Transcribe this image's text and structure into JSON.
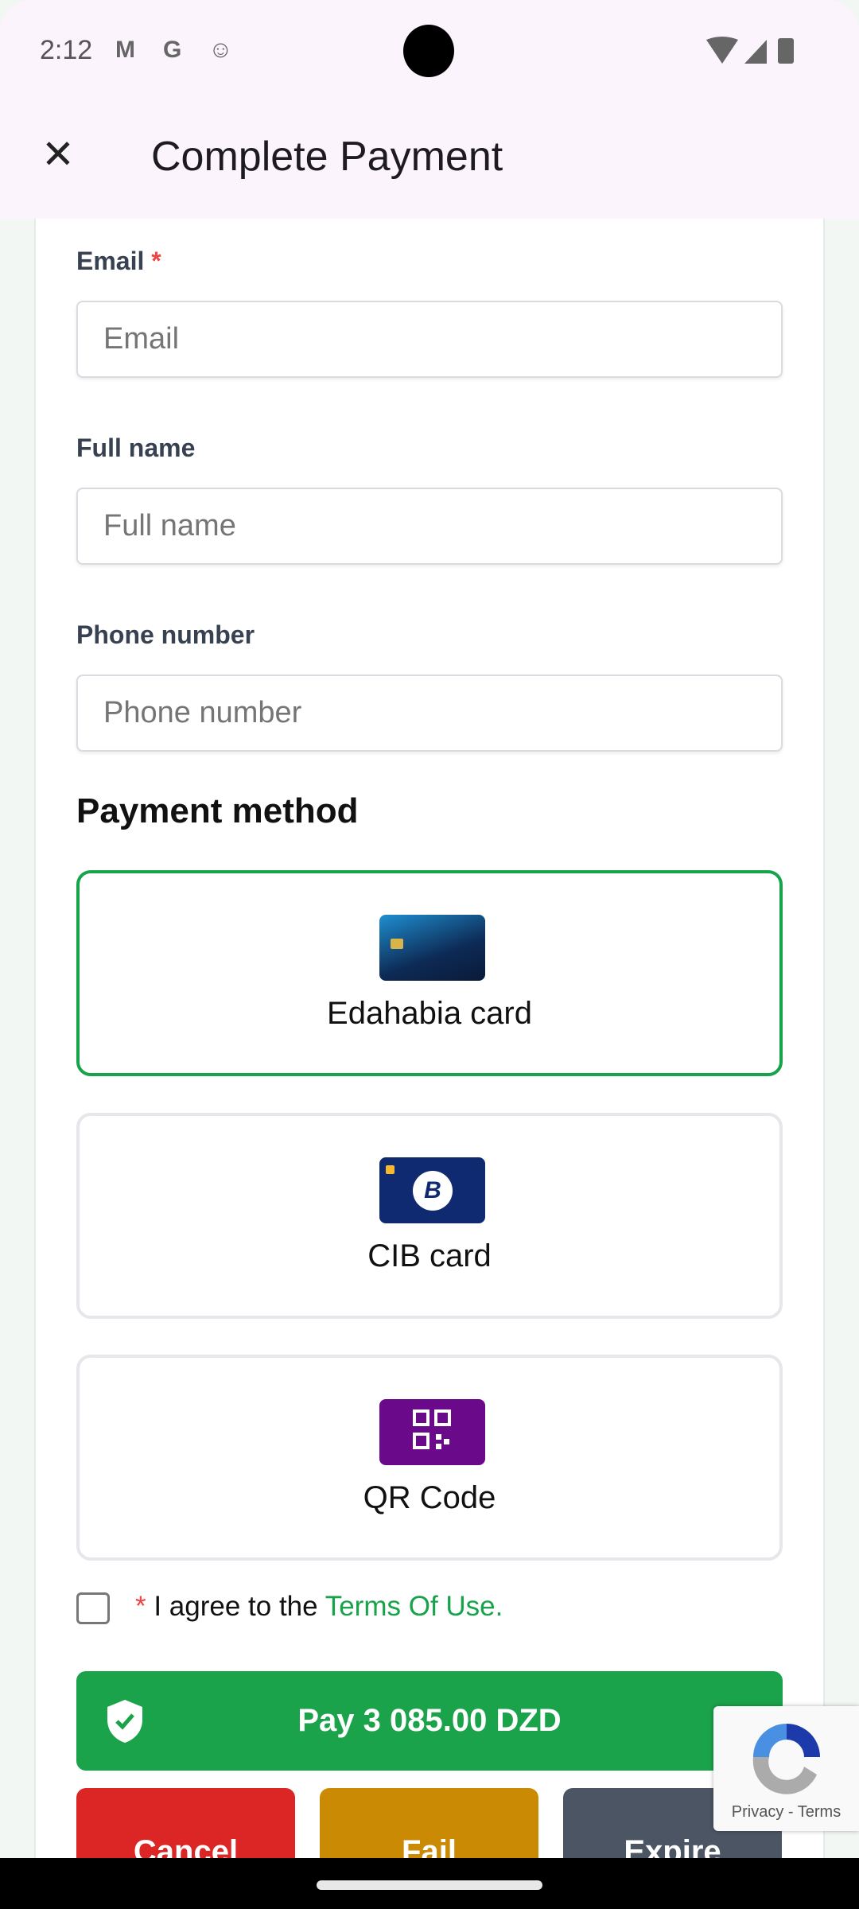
{
  "status_bar": {
    "time": "2:12",
    "icons": [
      "gmail-icon",
      "google-icon",
      "cat-icon",
      "wifi-icon",
      "signal-icon",
      "battery-icon"
    ]
  },
  "app_bar": {
    "title": "Complete Payment",
    "close_icon": "close-icon"
  },
  "form": {
    "email": {
      "label": "Email",
      "required": "*",
      "placeholder": "Email"
    },
    "full_name": {
      "label": "Full name",
      "placeholder": "Full name"
    },
    "phone": {
      "label": "Phone number",
      "placeholder": "Phone number"
    }
  },
  "payment": {
    "heading": "Payment method",
    "options": [
      {
        "label": "Edahabia card",
        "selected": true
      },
      {
        "label": "CIB card",
        "selected": false
      },
      {
        "label": "QR Code",
        "selected": false
      }
    ]
  },
  "agree": {
    "required": "*",
    "text": "I agree to the ",
    "link": "Terms Of Use."
  },
  "pay_button": "Pay 3 085.00 DZD",
  "actions": {
    "cancel": "Cancel",
    "fail": "Fail",
    "expire": "Expire"
  },
  "recaptcha": {
    "privacy": "Privacy",
    "sep": " - ",
    "terms": "Terms"
  },
  "colors": {
    "accent": "#16a34a",
    "cancel": "#dc2626",
    "fail": "#ca8a04",
    "expire": "#4b5563"
  }
}
